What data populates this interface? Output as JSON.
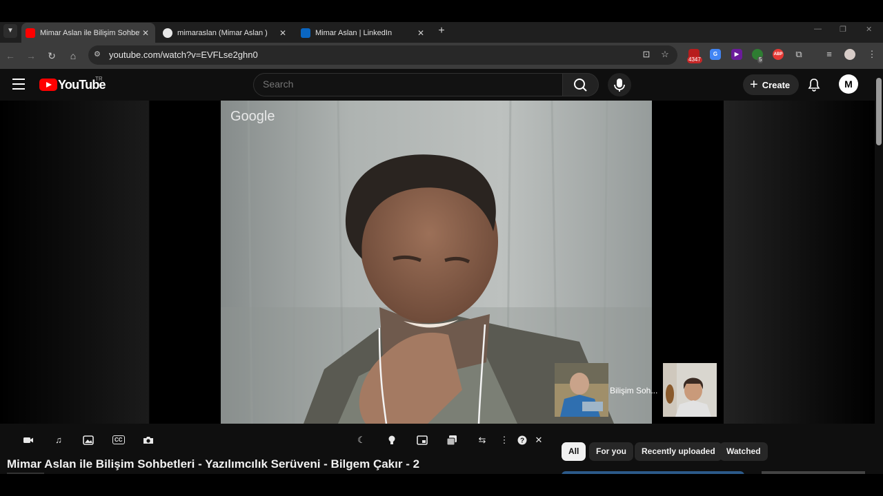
{
  "browser": {
    "tabs": [
      {
        "title": "Mimar Aslan ile Bilişim Sohbetleri",
        "active": true,
        "favicon": "youtube-favicon"
      },
      {
        "title": "mimaraslan (Mimar Aslan )",
        "active": false,
        "favicon": "github-favicon"
      },
      {
        "title": "Mimar Aslan | LinkedIn",
        "active": false,
        "favicon": "linkedin-favicon"
      }
    ],
    "new_tab": "+",
    "url": "youtube.com/watch?v=EVFLse2ghn0",
    "extension_badge_1": "4347",
    "extension_badge_2": "5",
    "extension_abp": "ABP",
    "nav_icons": [
      "back-arrow-icon",
      "forward-arrow-icon",
      "reload-icon",
      "home-icon"
    ]
  },
  "youtube": {
    "logo_text": "YouTube",
    "country_code": "TR",
    "search_placeholder": "Search",
    "create_label": "Create",
    "avatar_glyph": "M"
  },
  "player": {
    "watermark": "Google",
    "participant_label": "Bilişim Soh..."
  },
  "video_title": "Mimar Aslan ile Bilişim Sohbetleri - Yazılımcılık Serüveni - Bilgem Çakır - 2",
  "chips": [
    {
      "label": "All",
      "active": true
    },
    {
      "label": "For you",
      "active": false
    },
    {
      "label": "Recently uploaded",
      "active": false
    },
    {
      "label": "Watched",
      "active": false
    }
  ],
  "colors": {
    "youtube_red": "#ff0000",
    "page_bg": "#0f0f0f",
    "chrome_tab_active": "#3c3c3c"
  }
}
